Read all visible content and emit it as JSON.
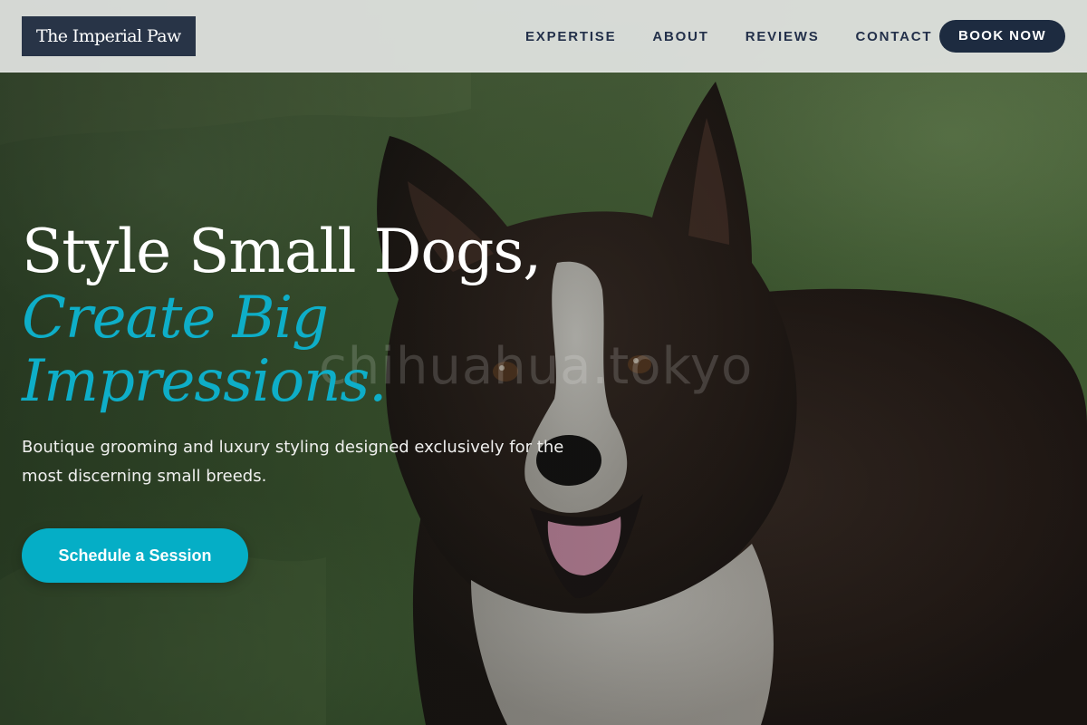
{
  "brand": {
    "name": "The Imperial Paw"
  },
  "nav": {
    "items": [
      {
        "label": "EXPERTISE"
      },
      {
        "label": "ABOUT"
      },
      {
        "label": "REVIEWS"
      },
      {
        "label": "CONTACT"
      }
    ],
    "cta_label": "BOOK NOW"
  },
  "hero": {
    "headline_line1": "Style Small Dogs,",
    "headline_line2": "Create Big",
    "headline_line3": "Impressions.",
    "subtext": "Boutique grooming and luxury styling designed exclusively for the most discerning small breeds.",
    "cta_label": "Schedule a Session",
    "image_description": "Border Collie with dark brown and white fur, mouth open, standing in green grass",
    "watermark": "chihuahua.tokyo"
  },
  "colors": {
    "header_bg": "#e2e4e2",
    "logo_bg": "#283447",
    "nav_text": "#23304a",
    "book_btn_bg": "#1d2b40",
    "accent": "#0eaec8",
    "cta_bg": "#05aec6",
    "grass": "#4c6a3a",
    "dog_fur": "#2e201b"
  },
  "icons": []
}
